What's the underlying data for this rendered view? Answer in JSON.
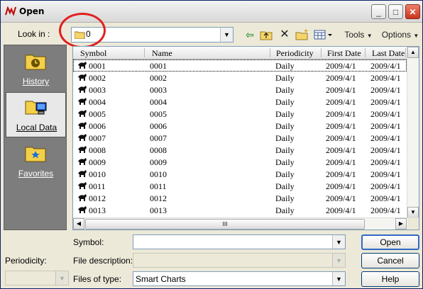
{
  "window": {
    "title": "Open"
  },
  "lookin": {
    "label": "Look in :",
    "value": "0"
  },
  "toolbar": {
    "tools_label": "Tools",
    "options_label": "Options"
  },
  "places": [
    {
      "label": "History"
    },
    {
      "label": "Local Data"
    },
    {
      "label": "Favorites"
    }
  ],
  "list": {
    "columns": [
      "Symbol",
      "Name",
      "Periodicity",
      "First Date",
      "Last Date"
    ],
    "rows": [
      [
        "0001",
        "0001",
        "Daily",
        "2009/4/1",
        "2009/4/1"
      ],
      [
        "0002",
        "0002",
        "Daily",
        "2009/4/1",
        "2009/4/1"
      ],
      [
        "0003",
        "0003",
        "Daily",
        "2009/4/1",
        "2009/4/1"
      ],
      [
        "0004",
        "0004",
        "Daily",
        "2009/4/1",
        "2009/4/1"
      ],
      [
        "0005",
        "0005",
        "Daily",
        "2009/4/1",
        "2009/4/1"
      ],
      [
        "0006",
        "0006",
        "Daily",
        "2009/4/1",
        "2009/4/1"
      ],
      [
        "0007",
        "0007",
        "Daily",
        "2009/4/1",
        "2009/4/1"
      ],
      [
        "0008",
        "0008",
        "Daily",
        "2009/4/1",
        "2009/4/1"
      ],
      [
        "0009",
        "0009",
        "Daily",
        "2009/4/1",
        "2009/4/1"
      ],
      [
        "0010",
        "0010",
        "Daily",
        "2009/4/1",
        "2009/4/1"
      ],
      [
        "0011",
        "0011",
        "Daily",
        "2009/4/1",
        "2009/4/1"
      ],
      [
        "0012",
        "0012",
        "Daily",
        "2009/4/1",
        "2009/4/1"
      ],
      [
        "0013",
        "0013",
        "Daily",
        "2009/4/1",
        "2009/4/1"
      ]
    ],
    "hscroll_grip": "III"
  },
  "form": {
    "symbol_label": "Symbol:",
    "symbol_value": "",
    "file_description_label": "File description:",
    "file_description_value": "",
    "periodicity_label": "Periodicity:",
    "periodicity_value": "",
    "files_of_type_label": "Files of type:",
    "files_of_type_value": "Smart Charts"
  },
  "buttons": {
    "open": "Open",
    "cancel": "Cancel",
    "help": "Help"
  },
  "colors": {
    "highlight_circle": "#e0201e",
    "places_bar": "#7d7d7d"
  }
}
